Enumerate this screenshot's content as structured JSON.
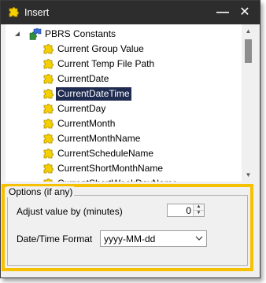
{
  "window": {
    "title": "Insert",
    "minimize_glyph": "—",
    "close_glyph": "✕"
  },
  "tree": {
    "root_label": "PBRS Constants",
    "items": [
      "Current Group Value",
      "Current Temp File Path",
      "CurrentDate",
      "CurrentDateTime",
      "CurrentDay",
      "CurrentMonth",
      "CurrentMonthName",
      "CurrentScheduleName",
      "CurrentShortMonthName",
      "CurrentShortWeekDayName"
    ],
    "selected_item": "CurrentDateTime",
    "item_icon": "puzzle-piece-icon",
    "root_icon": "puzzle-piece-icon"
  },
  "options": {
    "group_title": "Options (if any)",
    "adjust_label": "Adjust value by (minutes)",
    "adjust_value": "0",
    "format_label": "Date/Time Format",
    "format_value": "yyyy-MM-dd"
  },
  "colors": {
    "titlebar": "#2d2d2d",
    "selection": "#1f2b50",
    "highlight_border": "#f5c100"
  }
}
